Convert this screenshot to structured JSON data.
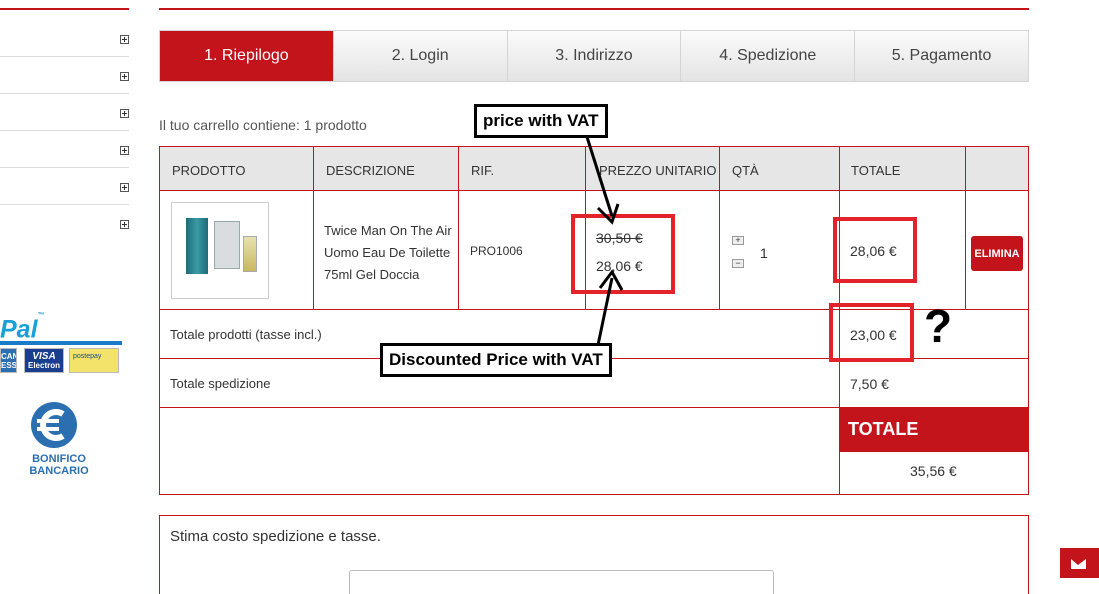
{
  "sidebar": {
    "items": [
      {
        "id": 1,
        "expand_icon": "plus-box-icon"
      },
      {
        "id": 2,
        "expand_icon": "plus-box-icon"
      },
      {
        "id": 3,
        "expand_icon": "plus-box-icon"
      },
      {
        "id": 4,
        "expand_icon": "plus-box-icon"
      },
      {
        "id": 5,
        "expand_icon": "plus-box-icon"
      },
      {
        "id": 6,
        "expand_icon": "plus-box-icon"
      }
    ],
    "payment_logos": {
      "paypal_text": "Pal",
      "paypal_tm": "™",
      "amex_text": "CAN\nESS",
      "visa_top": "VISA",
      "visa_bottom": "Electron",
      "postepay_text": "postepay",
      "bank_line1": "BONIFICO",
      "bank_line2": "BANCARIO"
    }
  },
  "steps": [
    {
      "label": "1. Riepilogo",
      "active": true
    },
    {
      "label": "2. Login",
      "active": false
    },
    {
      "label": "3. Indirizzo",
      "active": false
    },
    {
      "label": "4. Spedizione",
      "active": false
    },
    {
      "label": "5. Pagamento",
      "active": false
    }
  ],
  "cart": {
    "summary": "Il tuo carrello contiene: 1 prodotto",
    "headers": {
      "product": "PRODOTTO",
      "description": "DESCRIZIONE",
      "ref": "RIF.",
      "unit_price": "PREZZO UNITARIO",
      "qty": "QTÀ",
      "total": "TOTALE"
    },
    "item": {
      "description": "Twice Man On The Air Uomo Eau De Toilette 75ml Gel Doccia",
      "ref": "PRO1006",
      "old_price": "30,50 €",
      "price": "28,06 €",
      "qty": "1",
      "qty_plus": "+",
      "qty_minus": "−",
      "total": "28,06 €",
      "delete_label": "ELIMINA"
    },
    "totals": {
      "products_label": "Totale prodotti (tasse incl.)",
      "products_value": "23,00 €",
      "shipping_label": "Totale spedizione",
      "shipping_value": "7,50 €",
      "grand_label": "TOTALE",
      "grand_value": "35,56 €"
    }
  },
  "shipping_estimate": {
    "title": "Stima costo spedizione e tasse."
  },
  "annotations": {
    "vat_label": "price with VAT",
    "discount_label": "Discounted Price with VAT",
    "question": "?"
  },
  "colors": {
    "accent": "#c4141b",
    "highlight": "#e2232a"
  }
}
